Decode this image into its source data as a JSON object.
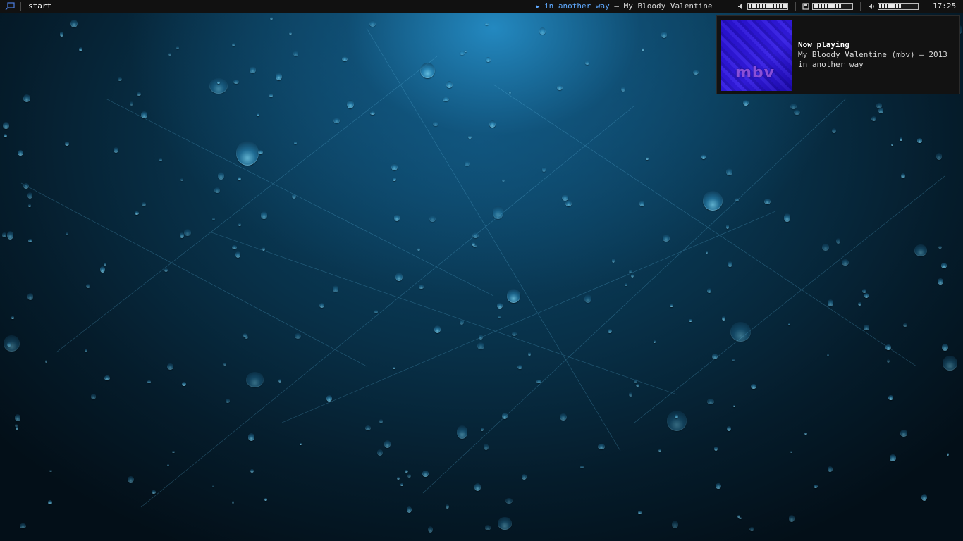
{
  "topbar": {
    "tag_label": "start",
    "now_playing": {
      "play_glyph": "▶",
      "title": "in another way",
      "separator": "–",
      "artist": "My Bloody Valentine"
    },
    "meters": [
      {
        "icon": "speaker-small-icon",
        "fraction": 1.0
      },
      {
        "icon": "disk-icon",
        "fraction": 0.75
      },
      {
        "icon": "volume-icon",
        "fraction": 0.6
      }
    ],
    "clock": "17:25"
  },
  "notification": {
    "heading": "Now playing",
    "line1": "My Bloody Valentine (mbv) – 2013",
    "line2": "in another way",
    "cover_logo": "mbv"
  },
  "colors": {
    "bar_bg": "#111111",
    "accent": "#5fa9ff",
    "cover_blue": "#2a18d0",
    "cover_logo": "#8a4fd8"
  }
}
